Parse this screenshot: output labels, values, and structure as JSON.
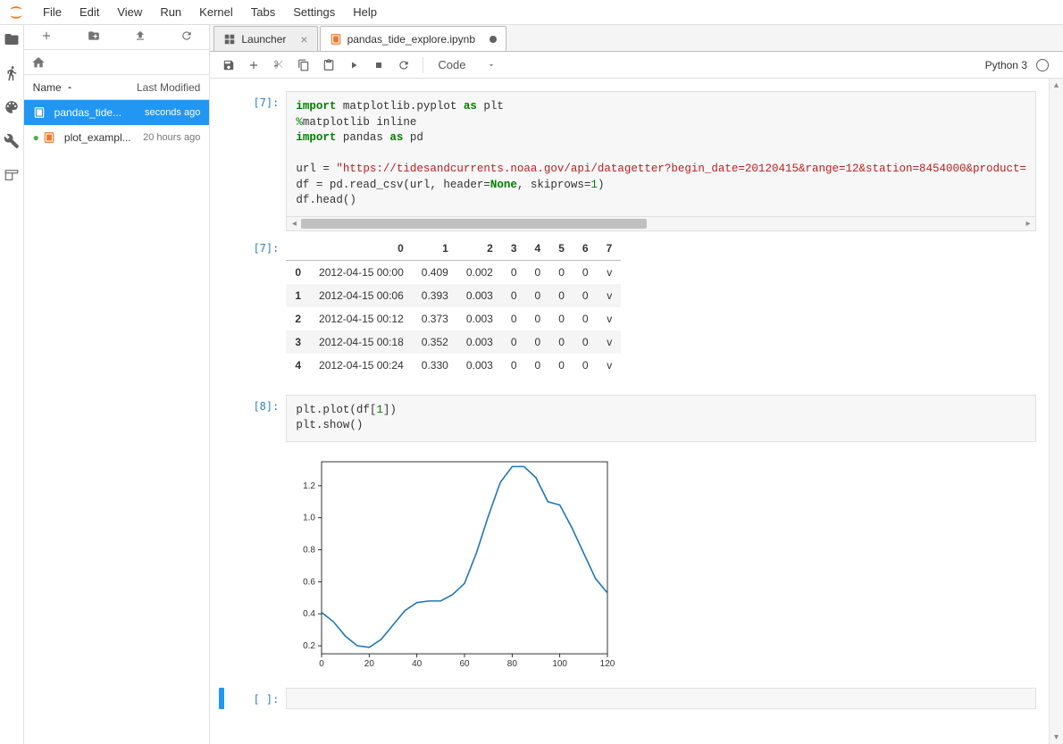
{
  "menu": [
    "File",
    "Edit",
    "View",
    "Run",
    "Kernel",
    "Tabs",
    "Settings",
    "Help"
  ],
  "filebrowser": {
    "header_name": "Name",
    "header_mod": "Last Modified",
    "files": [
      {
        "name": "pandas_tide...",
        "mod": "seconds ago",
        "selected": true,
        "color": "#fff",
        "icon": "#fff"
      },
      {
        "name": "plot_exampl...",
        "mod": "20 hours ago",
        "selected": false,
        "running": true
      }
    ]
  },
  "tabs": [
    {
      "label": "Launcher",
      "active": false,
      "closable": true,
      "icon": "launcher"
    },
    {
      "label": "pandas_tide_explore.ipynb",
      "active": true,
      "closable": false,
      "dirty": true,
      "icon": "nb"
    }
  ],
  "celltype": "Code",
  "kernel": "Python 3",
  "cells": {
    "c1": {
      "prompt": "[7]:",
      "code_tokens": [
        [
          "kw",
          "import"
        ],
        [
          "",
          " matplotlib.pyplot "
        ],
        [
          "kw",
          "as"
        ],
        [
          "",
          " plt\n"
        ],
        [
          "mg",
          "%"
        ],
        [
          "",
          "matplotlib inline\n"
        ],
        [
          "kw",
          "import"
        ],
        [
          "",
          " pandas "
        ],
        [
          "kw",
          "as"
        ],
        [
          "",
          " pd\n\n"
        ],
        [
          "",
          "url "
        ],
        [
          "",
          "= "
        ],
        [
          "str",
          "\"https://tidesandcurrents.noaa.gov/api/datagetter?begin_date=20120415&range=12&station=8454000&product="
        ],
        [
          "",
          "\n"
        ],
        [
          "",
          "df "
        ],
        [
          "",
          "= pd.read_csv(url, header="
        ],
        [
          "bn",
          "None"
        ],
        [
          "",
          ", skiprows="
        ],
        [
          "num",
          "1"
        ],
        [
          "",
          ")\n"
        ],
        [
          "",
          "df.head()"
        ]
      ]
    },
    "c1_out_prompt": "[7]:",
    "table": {
      "columns": [
        "",
        "0",
        "1",
        "2",
        "3",
        "4",
        "5",
        "6",
        "7"
      ],
      "rows": [
        [
          "0",
          "2012-04-15 00:00",
          "0.409",
          "0.002",
          "0",
          "0",
          "0",
          "0",
          "v"
        ],
        [
          "1",
          "2012-04-15 00:06",
          "0.393",
          "0.003",
          "0",
          "0",
          "0",
          "0",
          "v"
        ],
        [
          "2",
          "2012-04-15 00:12",
          "0.373",
          "0.003",
          "0",
          "0",
          "0",
          "0",
          "v"
        ],
        [
          "3",
          "2012-04-15 00:18",
          "0.352",
          "0.003",
          "0",
          "0",
          "0",
          "0",
          "v"
        ],
        [
          "4",
          "2012-04-15 00:24",
          "0.330",
          "0.003",
          "0",
          "0",
          "0",
          "0",
          "v"
        ]
      ]
    },
    "c2": {
      "prompt": "[8]:",
      "code_tokens": [
        [
          "",
          "plt.plot(df["
        ],
        [
          "num",
          "1"
        ],
        [
          "",
          "])\n"
        ],
        [
          "",
          "plt.show()"
        ]
      ]
    },
    "empty_prompt": "[ ]:"
  },
  "chart_data": {
    "type": "line",
    "x": [
      0,
      5,
      10,
      15,
      20,
      25,
      30,
      35,
      40,
      45,
      50,
      55,
      60,
      65,
      70,
      75,
      80,
      85,
      90,
      95,
      100,
      105,
      110,
      115,
      120
    ],
    "y": [
      0.409,
      0.35,
      0.26,
      0.2,
      0.19,
      0.24,
      0.33,
      0.42,
      0.47,
      0.48,
      0.48,
      0.52,
      0.59,
      0.78,
      1.01,
      1.22,
      1.32,
      1.32,
      1.25,
      1.1,
      1.08,
      0.94,
      0.78,
      0.62,
      0.53
    ],
    "xticks": [
      0,
      20,
      40,
      60,
      80,
      100,
      120
    ],
    "yticks": [
      0.2,
      0.4,
      0.6,
      0.8,
      1.0,
      1.2
    ],
    "xlim": [
      0,
      120
    ],
    "ylim": [
      0.15,
      1.35
    ]
  }
}
